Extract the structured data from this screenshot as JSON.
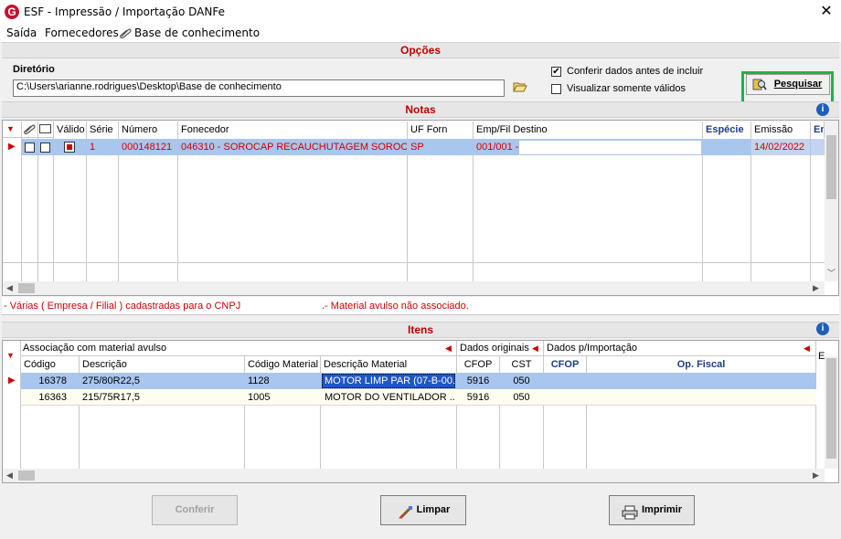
{
  "window": {
    "title": "ESF - Impressão / Importação DANFe",
    "logo_letter": "G",
    "close": "✕"
  },
  "menu": {
    "items": [
      "Saída",
      "Fornecedores",
      "Base de conhecimento"
    ]
  },
  "opcoes": {
    "section_title": "Opções",
    "dir_label": "Diretório",
    "dir_value": "C:\\Users\\arianne.rodrigues\\Desktop\\Base de conhecimento",
    "check_conferir": "Conferir dados antes de incluir",
    "check_validos": "Visualizar somente válidos",
    "search_button": "Pesquisar"
  },
  "notas": {
    "section_title": "Notas",
    "columns": [
      "Válido",
      "Série",
      "Número",
      "Fonecedor",
      "UF Forn",
      "Emp/Fil Destino",
      "Espécie",
      "Emissão",
      "En"
    ],
    "rows": [
      {
        "serie": "1",
        "numero": "000148121",
        "fornecedor": "046310 - SOROCAP RECAUCHUTAGEM SOROC...",
        "uf": "SP",
        "destino": "001/001 -",
        "especie": "",
        "emissao": "14/02/2022"
      }
    ],
    "legend_left": "- Várias ( Empresa / Filial ) cadastradas para o CNPJ",
    "legend_right": ".- Material avulso não associado."
  },
  "itens": {
    "section_title": "Itens",
    "group_assoc": "Associação com material avulso",
    "group_orig": "Dados originais",
    "group_import": "Dados p/Importação",
    "group_extra": "E",
    "columns": [
      "Código",
      "Descrição",
      "Código Material",
      "Descrição Material",
      "CFOP",
      "CST",
      "CFOP",
      "Op. Fiscal"
    ],
    "rows": [
      {
        "codigo": "16378",
        "descricao": "275/80R22,5",
        "cod_mat": "1128",
        "desc_mat": "MOTOR LIMP PAR (07-B-00...",
        "cfop": "5916",
        "cst": "050",
        "cfop2": "",
        "op": ""
      },
      {
        "codigo": "16363",
        "descricao": "215/75R17,5",
        "cod_mat": "1005",
        "desc_mat": "MOTOR DO VENTILADOR ...",
        "cfop": "5916",
        "cst": "050",
        "cfop2": "",
        "op": ""
      }
    ]
  },
  "buttons": {
    "conferir": "Conferir",
    "limpar": "Limpar",
    "imprimir": "Imprimir"
  },
  "colors": {
    "selection": "#a9c6ef",
    "highlight": "#22b14c",
    "section_red": "#c00000",
    "row_alt": "#fffdf0"
  }
}
